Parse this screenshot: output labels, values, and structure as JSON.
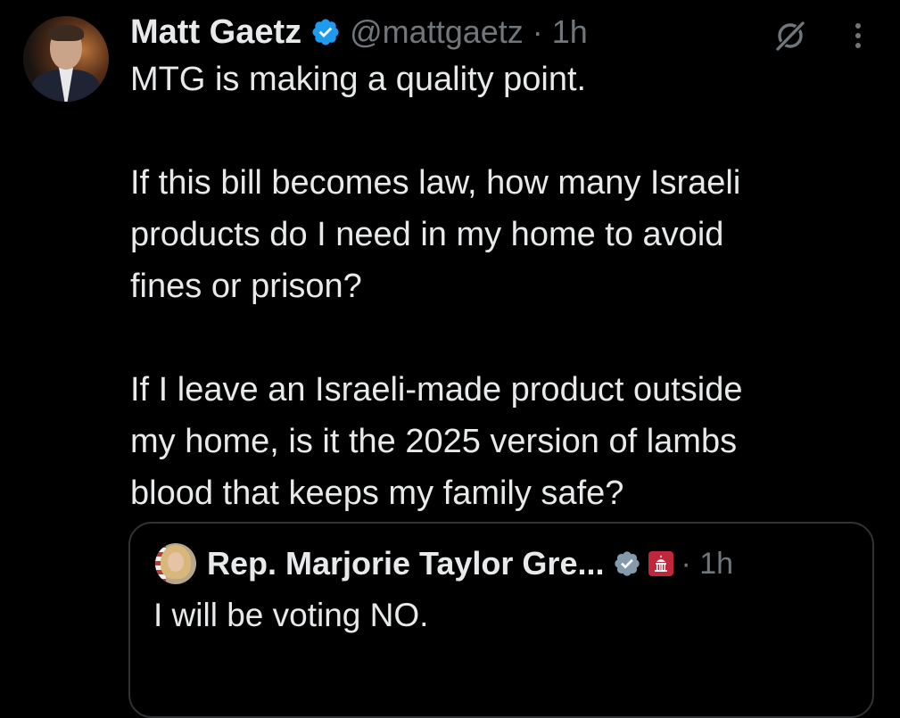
{
  "author": {
    "display_name": "Matt Gaetz",
    "handle_time": "@mattgaetz · 1h",
    "verified_color": "#1d9bf0"
  },
  "tweet": {
    "paragraphs": [
      [
        "MTG is making a quality point."
      ],
      [
        "If this bill becomes law, how many Israeli",
        "products do I need in my home to avoid",
        "fines or prison?"
      ],
      [
        "If I leave an Israeli-made product outside",
        "my home, is it the 2025 version of lambs",
        "blood that keeps my family safe?"
      ]
    ]
  },
  "icons": {
    "grok": "grok-icon",
    "more": "more-vertical-icon"
  },
  "quoted_tweet": {
    "display_name": "Rep. Marjorie Taylor Gre...",
    "time": "· 1h",
    "text": "I will be voting NO.",
    "verified_color": "#829aab",
    "gov_badge_color": "#c0263c"
  },
  "colors": {
    "background": "#000000",
    "text": "#e7e9ea",
    "secondary": "#71767b",
    "border": "#2f3336"
  }
}
